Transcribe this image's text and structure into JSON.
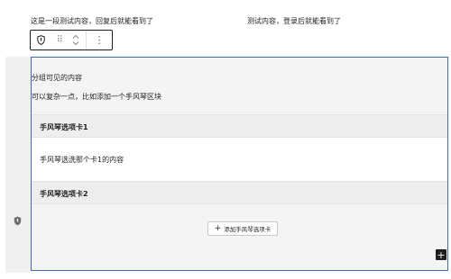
{
  "top": {
    "left_text": "这是一段测试内容，回复后就能看到了",
    "right_text": "测试内容，登录后就能看到了"
  },
  "toolbar": {
    "icons": [
      "shield-icon",
      "drag-handle-icon",
      "move-up-down-icon",
      "more-options-icon"
    ],
    "drag_glyph": "⠿",
    "more_glyph": "⋮"
  },
  "group": {
    "line1": "分组可见的内容",
    "line2": "可以复杂一点，比如添加一个手风琴区块",
    "accordion": [
      {
        "title": "手风琴选项卡1",
        "content": "手风琴选洗那个卡1的内容"
      },
      {
        "title": "手风琴选项卡2"
      }
    ],
    "add_button_label": "添加手风琴选项卡",
    "add_button_plus": "+",
    "inserter_plus": "+"
  },
  "colors": {
    "selection_border": "#3a6fb6",
    "block_background": "#f4f4f4",
    "gutter_background": "#f0f0f0"
  }
}
